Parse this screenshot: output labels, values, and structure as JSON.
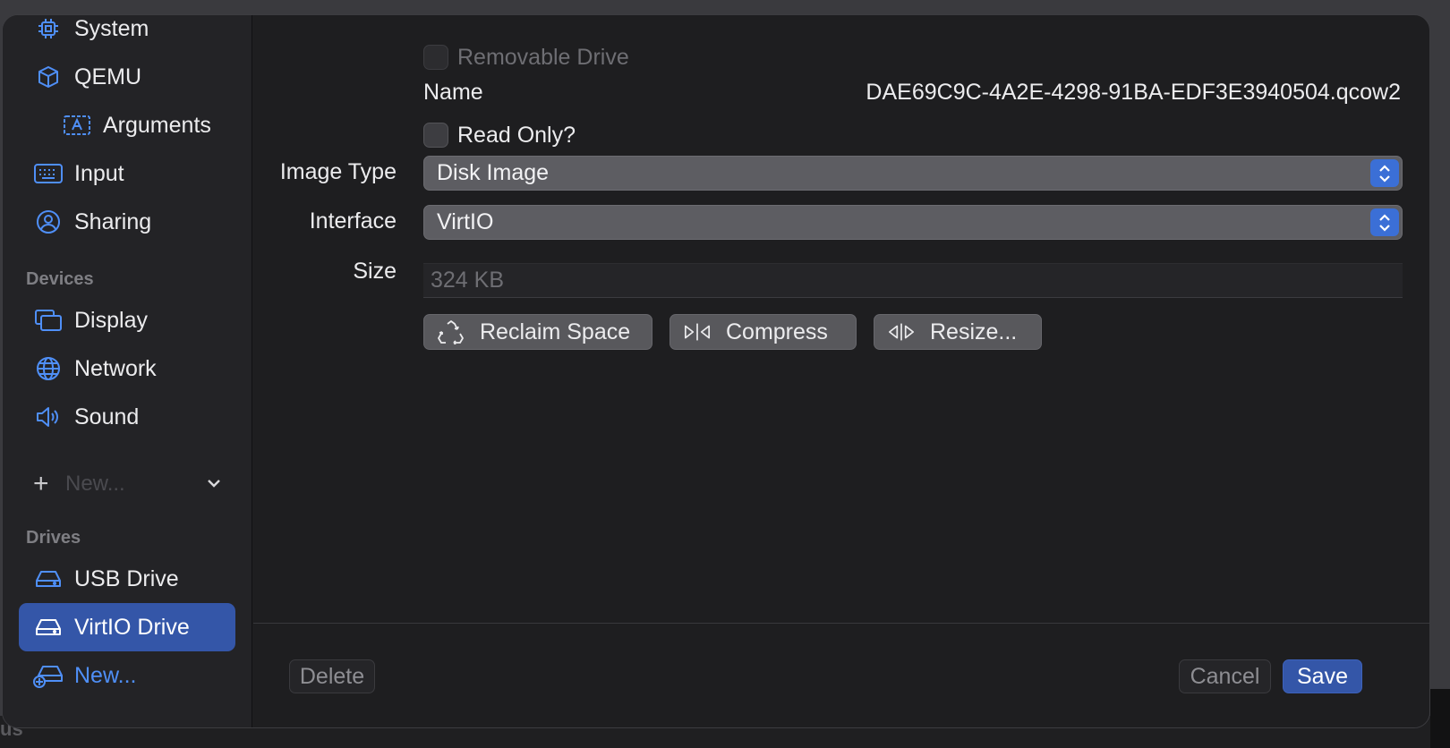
{
  "sidebar": {
    "items_top": [
      {
        "label": "System",
        "icon": "cpu-icon"
      },
      {
        "label": "QEMU",
        "icon": "cube-icon"
      },
      {
        "label": "Arguments",
        "icon": "text-box-icon"
      },
      {
        "label": "Input",
        "icon": "keyboard-icon"
      },
      {
        "label": "Sharing",
        "icon": "person-circle-icon"
      }
    ],
    "devices_header": "Devices",
    "devices": [
      {
        "label": "Display",
        "icon": "display-icon"
      },
      {
        "label": "Network",
        "icon": "globe-icon"
      },
      {
        "label": "Sound",
        "icon": "speaker-icon"
      }
    ],
    "new_device_placeholder": "New...",
    "drives_header": "Drives",
    "drives": [
      {
        "label": "USB Drive",
        "icon": "drive-icon"
      },
      {
        "label": "VirtIO Drive",
        "icon": "drive-icon",
        "selected": true
      }
    ],
    "new_drive_label": "New..."
  },
  "drive": {
    "removable_label": "Removable Drive",
    "removable_checked": false,
    "name_label": "Name",
    "name_value": "DAE69C9C-4A2E-4298-91BA-EDF3E3940504.qcow2",
    "read_only_label": "Read Only?",
    "read_only_checked": false,
    "image_type_label": "Image Type",
    "image_type_value": "Disk Image",
    "interface_label": "Interface",
    "interface_value": "VirtIO",
    "size_label": "Size",
    "size_value": "324 KB",
    "reclaim_label": "Reclaim Space",
    "compress_label": "Compress",
    "resize_label": "Resize..."
  },
  "footer": {
    "delete_label": "Delete",
    "cancel_label": "Cancel",
    "save_label": "Save"
  },
  "colors": {
    "accent": "#4f8ff7",
    "selection": "#3456a8",
    "window_bg": "#1e1e20",
    "sidebar_bg": "#232326"
  }
}
